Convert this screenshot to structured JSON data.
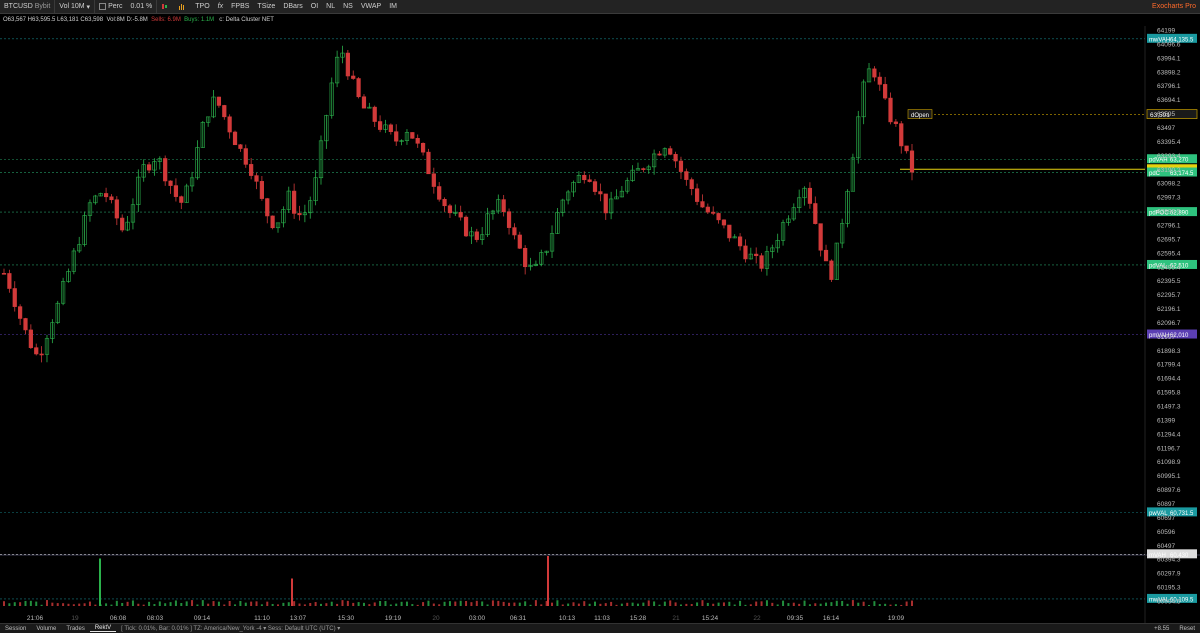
{
  "toolbar": {
    "symbol": "BTCUSD",
    "exchange": "Bybit",
    "timeframe": "Vol 10M",
    "perc": "Perc",
    "tick": "0.01",
    "pct": "%",
    "tpo": "TPO",
    "fx": "fx",
    "fpbs": "FPBS",
    "tsize": "TSize",
    "dbars": "DBars",
    "oi": "OI",
    "nl": "NL",
    "ns": "NS",
    "vwap": "VWAP",
    "im": "IM",
    "brand": "Exocharts Pro"
  },
  "infobar": {
    "ohlc": "O63,567 H63,595.5 L63,181 C63,598",
    "vol": "Vol:8M D:-5.8M",
    "sells": "Sells: 6.9M",
    "buys": "Buys: 1.1M",
    "template": "c: Delta Cluster NET"
  },
  "bottombar": {
    "tabs": [
      "Session",
      "Volume",
      "Trades",
      "RektV"
    ],
    "active_tab": "RektV",
    "status": "[ Tick: 0.01%, Bar: 0.01% ]   TZ: America/New_York -4 ▾   Sess: Default UTC (UTC) ▾",
    "zoom": "+8.55",
    "reset": "Reset"
  },
  "colors": {
    "up": "#2bb24c",
    "down": "#d23a3a",
    "background": "#000000",
    "price_tag": "#e7d20f",
    "level_green": "#2ec27e",
    "level_teal": "#1a9aa0",
    "level_purple": "#5b3fb3"
  },
  "chart_data": {
    "type": "candlestick",
    "y_axis_ticks": [
      "64199",
      "64096.6",
      "63994.1",
      "63898.2",
      "63796.1",
      "63694.1",
      "63595",
      "63497",
      "63395.4",
      "63293.4",
      "63190.2",
      "63098.2",
      "62997.3",
      "62898.5",
      "62796.1",
      "62695.7",
      "62595.4",
      "62495.4",
      "62395.5",
      "62295.7",
      "62196.1",
      "62096.7",
      "61997",
      "61898.3",
      "61799.4",
      "61694.4",
      "61595.8",
      "61497.3",
      "61399",
      "61294.4",
      "61196.7",
      "61098.9",
      "60995.1",
      "60897.6",
      "60897",
      "60697",
      "60596",
      "60497",
      "60394.3",
      "60297.9",
      "60195.3",
      "60094.5"
    ],
    "x_axis_ticks": [
      "21:06",
      "19",
      "06:08",
      "08:03",
      "09:14",
      "11:10",
      "13:07",
      "15:30",
      "19:19",
      "20",
      "03:00",
      "06:31",
      "10:13",
      "11:03",
      "15:28",
      "21",
      "15:24",
      "22",
      "09:35",
      "16:14",
      "19:09"
    ],
    "price_range": [
      60094.5,
      64199
    ],
    "levels": [
      {
        "label": "mwVAH",
        "value": "64,135.5",
        "price": 64135.5,
        "color": "#1a9aa0"
      },
      {
        "label": "dOpen",
        "value": "",
        "price": 63591,
        "color": "#c8a000"
      },
      {
        "label": "63,591",
        "value": "",
        "price": 63591,
        "color": "#c8a000"
      },
      {
        "label": "pdVAH",
        "value": "63,270",
        "price": 63270,
        "color": "#2ec27e"
      },
      {
        "label": "BTCUSD",
        "value": "63,198",
        "price": 63198,
        "color": "#e7d20f"
      },
      {
        "label": "pdC",
        "value": "63,174.5",
        "price": 63174.5,
        "color": "#2ec27e"
      },
      {
        "label": "pdPOC",
        "value": "62,890",
        "price": 62890,
        "color": "#2ec27e"
      },
      {
        "label": "pdVAL",
        "value": "62,510",
        "price": 62510,
        "color": "#2ec27e"
      },
      {
        "label": "pmVAH",
        "value": "62,010",
        "price": 62010,
        "color": "#5b3fb3"
      },
      {
        "label": "pwVAL",
        "value": "60,731.5",
        "price": 60731.5,
        "color": "#1a9aa0"
      },
      {
        "label": "mVAH",
        "value": "60,430",
        "price": 60430,
        "color": "#dddddd"
      },
      {
        "label": "mwVAL",
        "value": "60,109.5",
        "price": 60109.5,
        "color": "#1a9aa0"
      }
    ],
    "series": [
      {
        "name": "BTCUSD",
        "close_path": [
          62450,
          62350,
          62200,
          62050,
          61950,
          61850,
          61950,
          62100,
          62200,
          62350,
          62500,
          62650,
          62800,
          62950,
          63000,
          63050,
          62950,
          62850,
          62750,
          62900,
          63050,
          63200,
          63250,
          63300,
          63200,
          63100,
          63000,
          62950,
          63100,
          63300,
          63500,
          63650,
          63700,
          63600,
          63500,
          63400,
          63300,
          63250,
          63100,
          62950,
          62850,
          62800,
          62900,
          63000,
          62900,
          62850,
          62950,
          63100,
          63400,
          63700,
          63950,
          64050,
          63900,
          63750,
          63650,
          63600,
          63550,
          63500,
          63450,
          63400,
          63450,
          63500,
          63400,
          63300,
          63200,
          63100,
          63000,
          62900,
          62850,
          62800,
          62750,
          62700,
          62750,
          62850,
          62900,
          62950,
          62850,
          62700,
          62600,
          62500,
          62450,
          62550,
          62650,
          62800,
          62950,
          63050,
          63100,
          63150,
          63200,
          63100,
          63000,
          62900,
          62950,
          63050,
          63100,
          63150,
          63200,
          63250,
          63300,
          63350,
          63400,
          63300,
          63200,
          63100,
          63050,
          62950,
          62900,
          62850,
          62800,
          62750,
          62700,
          62650,
          62600,
          62550,
          62500,
          62550,
          62650,
          62750,
          62850,
          62950,
          63050,
          63100,
          62900,
          62700,
          62500,
          62450,
          62700,
          63000,
          63300,
          63600,
          63850,
          63950,
          63800,
          63650,
          63550,
          63450,
          63300,
          63198
        ]
      }
    ],
    "volume_spikes": [
      {
        "x_index": 12,
        "height": 0.95,
        "color": "up"
      },
      {
        "x_index": 36,
        "height": 0.55,
        "color": "down"
      },
      {
        "x_index": 68,
        "height": 1.0,
        "color": "down"
      }
    ]
  }
}
